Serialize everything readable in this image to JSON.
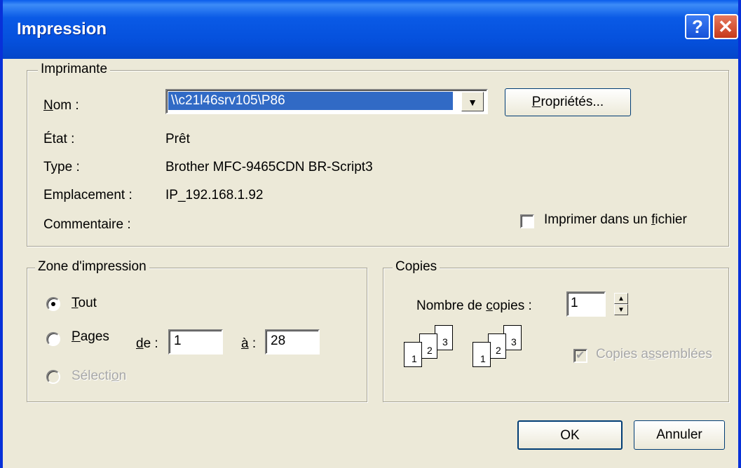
{
  "window": {
    "title": "Impression"
  },
  "printer": {
    "group_label": "Imprimante",
    "name_label_u": "N",
    "name_label_rest": "om :",
    "name_value": "\\\\c21l46srv105\\P86",
    "properties_u": "P",
    "properties_rest": "ropriétés...",
    "status_label": "État :",
    "status_value": "Prêt",
    "type_label": "Type :",
    "type_value": "Brother MFC-9465CDN BR-Script3",
    "location_label": "Emplacement :",
    "location_value": "IP_192.168.1.92",
    "comment_label": "Commentaire :",
    "print_to_file_pre": "Imprimer dans un ",
    "print_to_file_u": "f",
    "print_to_file_post": "ichier"
  },
  "range": {
    "group_label": "Zone d'impression",
    "all_u": "T",
    "all_rest": "out",
    "pages_u": "P",
    "pages_rest": "ages",
    "from_u": "d",
    "from_rest": "e :",
    "from_value": "1",
    "to_u": "à",
    "to_rest": " :",
    "to_value": "28",
    "selection_pre": "Sélecti",
    "selection_u": "o",
    "selection_post": "n"
  },
  "copies": {
    "group_label": "Copies",
    "count_pre": "Nombre de ",
    "count_u": "c",
    "count_post": "opies :",
    "count_value": "1",
    "collate_pre": "Copies a",
    "collate_u": "s",
    "collate_post": "semblées",
    "page_numbers": [
      "1",
      "2",
      "3"
    ]
  },
  "buttons": {
    "ok": "OK",
    "cancel": "Annuler"
  }
}
